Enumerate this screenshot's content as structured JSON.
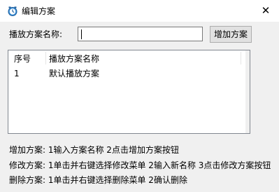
{
  "window": {
    "title": "编辑方案",
    "close_glyph": "✕",
    "icon": "schedule-icon"
  },
  "form": {
    "name_label": "播放方案名称:",
    "name_value": "",
    "add_button": "增加方案"
  },
  "list": {
    "headers": [
      "序号",
      "播放方案名称"
    ],
    "rows": [
      {
        "index": "1",
        "name": "默认播放方案"
      }
    ]
  },
  "instructions": [
    "增加方案: 1输入方案名称 2点击增加方案按钮",
    "修改方案: 1单击并右键选择修改菜单 2输入新名称 3点击修改方案按钮",
    "删除方案: 1单击并右键选择删除菜单 2确认删除"
  ]
}
